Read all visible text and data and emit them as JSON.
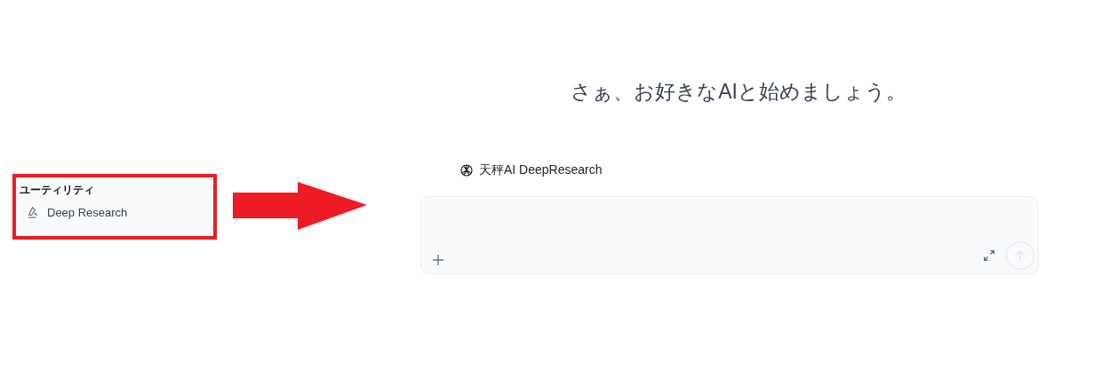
{
  "sidebar_callout": {
    "section_label": "ユーティリティ",
    "items": [
      {
        "label": "Deep Research"
      }
    ]
  },
  "main": {
    "greeting": "さぁ、お好きなAIと始めましょう。",
    "model": {
      "name": "天秤AI DeepResearch"
    },
    "composer": {
      "send_disabled": true
    }
  }
}
